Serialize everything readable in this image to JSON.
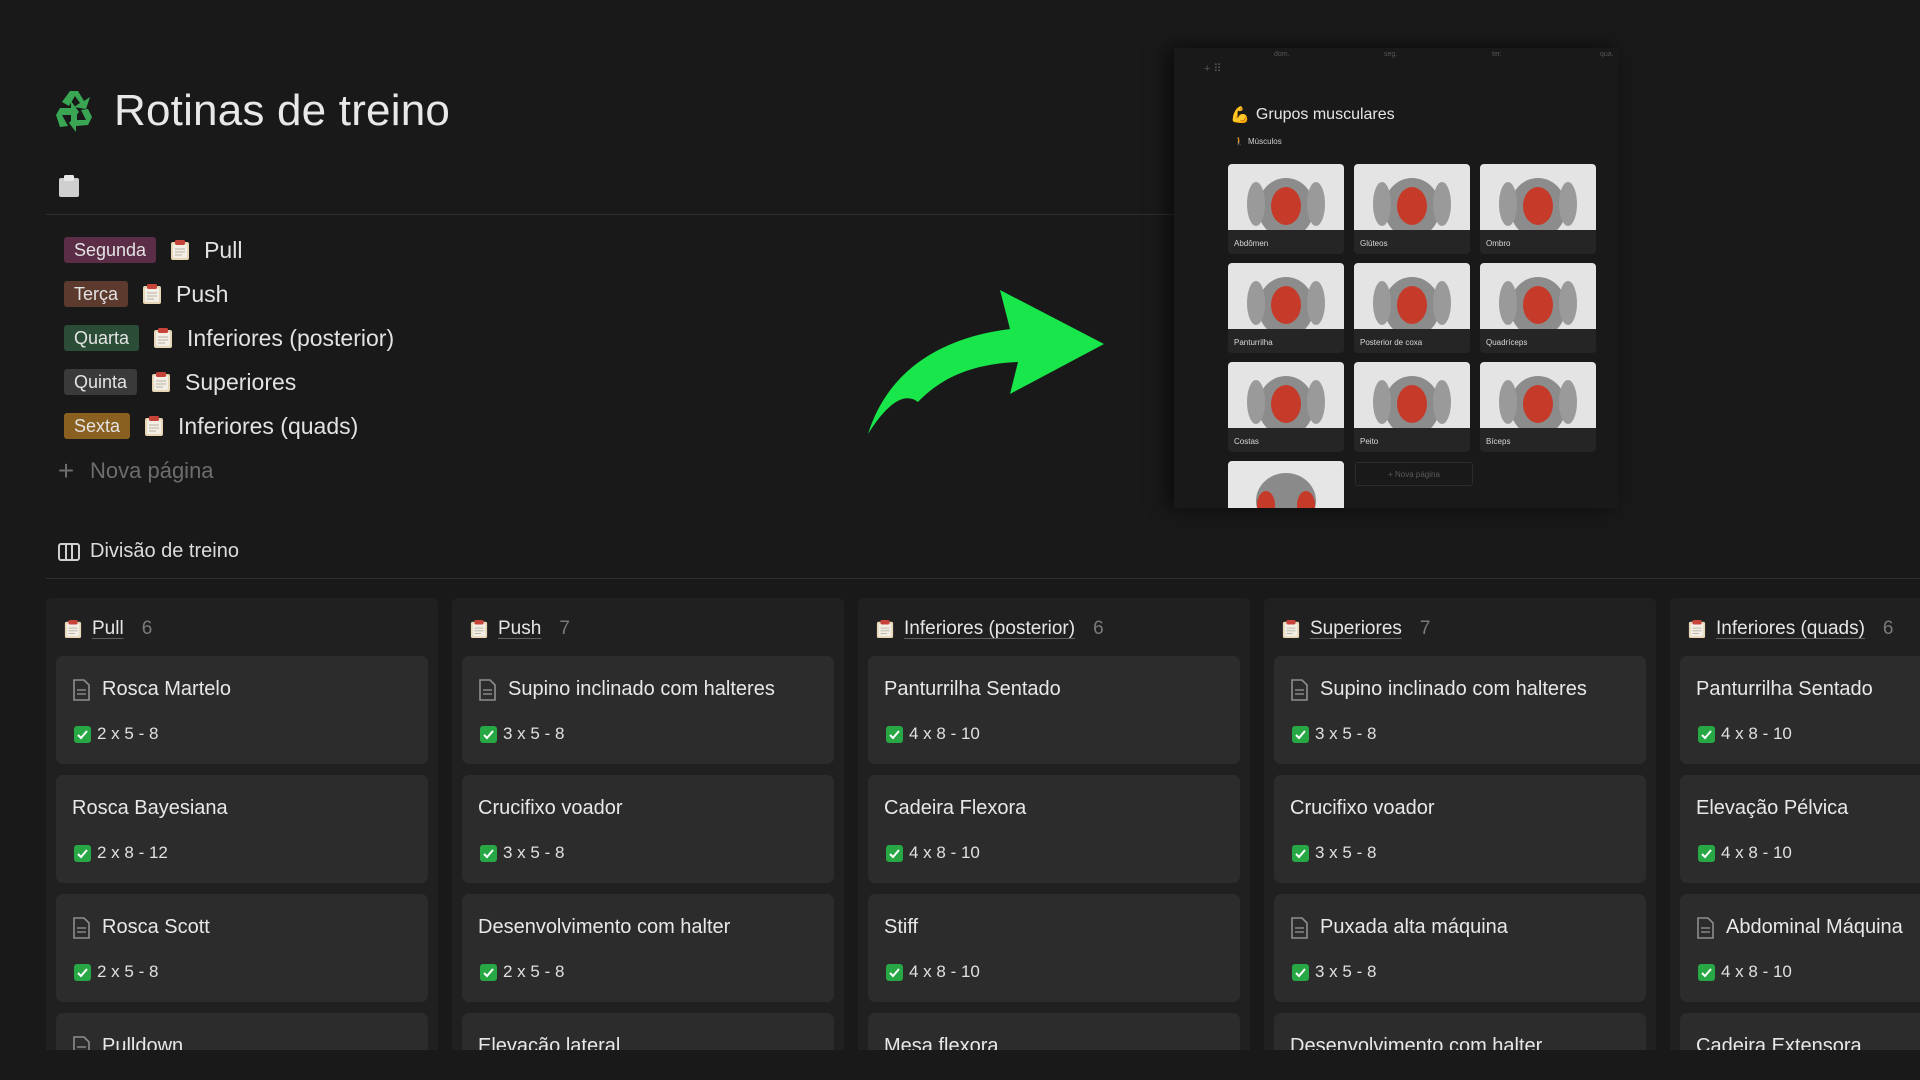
{
  "page": {
    "title": "Rotinas de treino",
    "title_icon": "recycle-icon",
    "accent_colors": {
      "arrow": "#19e64a",
      "check": "#27a844"
    }
  },
  "routines": [
    {
      "day": "Segunda",
      "day_color": "#5b2d47",
      "name": "Pull"
    },
    {
      "day": "Terça",
      "day_color": "#5c3a2e",
      "name": "Push"
    },
    {
      "day": "Quarta",
      "day_color": "#2b4d38",
      "name": "Inferiores (posterior)"
    },
    {
      "day": "Quinta",
      "day_color": "#3a3a3a",
      "name": "Superiores"
    },
    {
      "day": "Sexta",
      "day_color": "#8a6020",
      "name": "Inferiores (quads)"
    }
  ],
  "new_page_label": "Nova página",
  "overlay": {
    "axis_labels": [
      "dom.",
      "seg.",
      "ter.",
      "qua."
    ],
    "title": "Grupos musculares",
    "subtitle": "Músculos",
    "muscles": [
      "Abdômen",
      "Glúteos",
      "Ombro",
      "Panturrilha",
      "Posterior de coxa",
      "Quadríceps",
      "Costas",
      "Peito",
      "Bíceps"
    ],
    "new_page_label": "+ Nova página"
  },
  "board": {
    "title": "Divisão de treino",
    "columns": [
      {
        "name": "Pull",
        "count": "6",
        "cards": [
          {
            "title": "Rosca Martelo",
            "sets": "2 x 5 - 8",
            "doc": true
          },
          {
            "title": "Rosca Bayesiana",
            "sets": "2 x 8 - 12",
            "doc": false
          },
          {
            "title": "Rosca Scott",
            "sets": "2 x 5 - 8",
            "doc": true
          },
          {
            "title": "Pulldown",
            "sets": "",
            "doc": true
          }
        ]
      },
      {
        "name": "Push",
        "count": "7",
        "cards": [
          {
            "title": "Supino inclinado com halteres",
            "sets": "3 x 5 - 8",
            "doc": true
          },
          {
            "title": "Crucifixo voador",
            "sets": "3 x 5 - 8",
            "doc": false
          },
          {
            "title": "Desenvolvimento com halter",
            "sets": "2 x 5 - 8",
            "doc": false
          },
          {
            "title": "Elevação lateral",
            "sets": "",
            "doc": false
          }
        ]
      },
      {
        "name": "Inferiores (posterior)",
        "count": "6",
        "cards": [
          {
            "title": "Panturrilha Sentado",
            "sets": "4 x 8 - 10",
            "doc": false
          },
          {
            "title": "Cadeira Flexora",
            "sets": "4 x 8 - 10",
            "doc": false
          },
          {
            "title": "Stiff",
            "sets": "4 x 8 - 10",
            "doc": false
          },
          {
            "title": "Mesa flexora",
            "sets": "",
            "doc": false
          }
        ]
      },
      {
        "name": "Superiores",
        "count": "7",
        "cards": [
          {
            "title": "Supino inclinado com halteres",
            "sets": "3 x 5 - 8",
            "doc": true
          },
          {
            "title": "Crucifixo voador",
            "sets": "3 x 5 - 8",
            "doc": false
          },
          {
            "title": "Puxada alta máquina",
            "sets": "3 x 5 - 8",
            "doc": true
          },
          {
            "title": "Desenvolvimento com halter",
            "sets": "",
            "doc": false
          }
        ]
      },
      {
        "name": "Inferiores (quads)",
        "count": "6",
        "cards": [
          {
            "title": "Panturrilha Sentado",
            "sets": "4 x 8 - 10",
            "doc": false
          },
          {
            "title": "Elevação Pélvica",
            "sets": "4 x 8 - 10",
            "doc": false
          },
          {
            "title": "Abdominal Máquina",
            "sets": "4 x 8 - 10",
            "doc": true
          },
          {
            "title": "Cadeira Extensora",
            "sets": "",
            "doc": false
          }
        ]
      }
    ]
  }
}
